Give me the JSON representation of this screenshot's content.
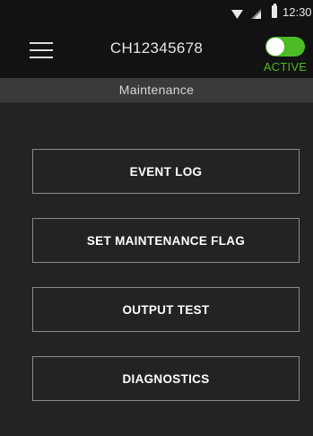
{
  "status_bar": {
    "time": "12:30",
    "icons": [
      "wifi-icon",
      "signal-icon",
      "battery-icon"
    ]
  },
  "header": {
    "title": "CH12345678",
    "menu_icon": "hamburger-menu-icon",
    "toggle": {
      "label": "ACTIVE",
      "state": "on",
      "color": "#4cbb25"
    }
  },
  "subheader": {
    "title": "Maintenance"
  },
  "menu": {
    "items": [
      {
        "label": "EVENT LOG"
      },
      {
        "label": "SET MAINTENANCE FLAG"
      },
      {
        "label": "OUTPUT TEST"
      },
      {
        "label": "DIAGNOSTICS"
      }
    ]
  },
  "colors": {
    "background": "#232323",
    "header": "#121212",
    "subheader": "#3a3a3a",
    "button_border": "#8a8a8a",
    "accent": "#4cbb25"
  }
}
